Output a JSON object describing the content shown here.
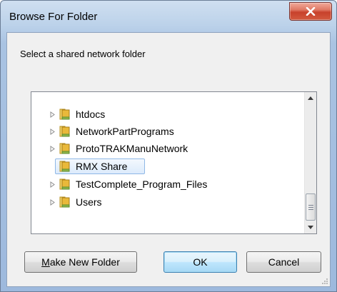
{
  "window": {
    "title": "Browse For Folder"
  },
  "instruction": "Select a shared network folder",
  "tree": {
    "items": [
      {
        "label": "htdocs",
        "expandable": true,
        "selected": false
      },
      {
        "label": "NetworkPartPrograms",
        "expandable": true,
        "selected": false
      },
      {
        "label": "ProtoTRAKManuNetwork",
        "expandable": true,
        "selected": false
      },
      {
        "label": "RMX Share",
        "expandable": false,
        "selected": true
      },
      {
        "label": "TestComplete_Program_Files",
        "expandable": true,
        "selected": false
      },
      {
        "label": "Users",
        "expandable": true,
        "selected": false
      }
    ]
  },
  "buttons": {
    "make_new_folder_mnemonic": "M",
    "make_new_folder_rest": "ake New Folder",
    "ok": "OK",
    "cancel": "Cancel"
  },
  "colors": {
    "selection_fill": "#dcebfc",
    "selection_border": "#8fb8e6",
    "close": "#c8412b",
    "folder": "#e8c04a"
  },
  "icons": {
    "close": "close-icon",
    "folder": "folder-icon",
    "expander": "triangle-right-icon"
  }
}
